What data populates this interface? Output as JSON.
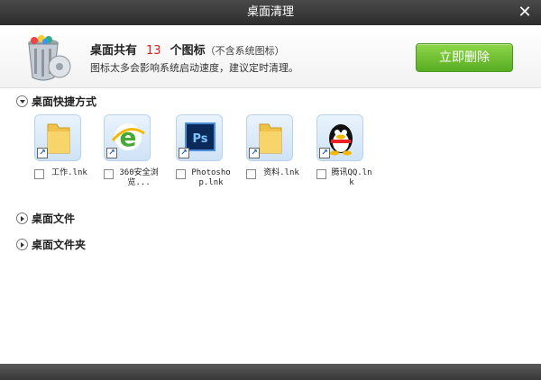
{
  "window": {
    "title": "桌面清理",
    "close_glyph": "✕"
  },
  "summary": {
    "prefix": "桌面共有",
    "count": "13",
    "suffix": "个图标",
    "note": "（不含系统图标）",
    "subtitle": "图标太多会影响系统启动速度，建议定时清理。",
    "delete_label": "立即删除"
  },
  "sections": {
    "shortcuts_label": "桌面快捷方式",
    "files_label": "桌面文件",
    "folders_label": "桌面文件夹"
  },
  "shortcuts": [
    {
      "label": "工作.lnk",
      "icon": "folder-icon"
    },
    {
      "label": "360安全浏览...",
      "icon": "360-browser-icon"
    },
    {
      "label": "Photoshop.lnk",
      "icon": "photoshop-icon"
    },
    {
      "label": "资料.lnk",
      "icon": "folder-icon"
    },
    {
      "label": "腾讯QQ.lnk",
      "icon": "qq-penguin-icon"
    }
  ],
  "colors": {
    "count_red": "#e02020",
    "button_green": "#6cbf34",
    "titlebar": "#333333"
  }
}
